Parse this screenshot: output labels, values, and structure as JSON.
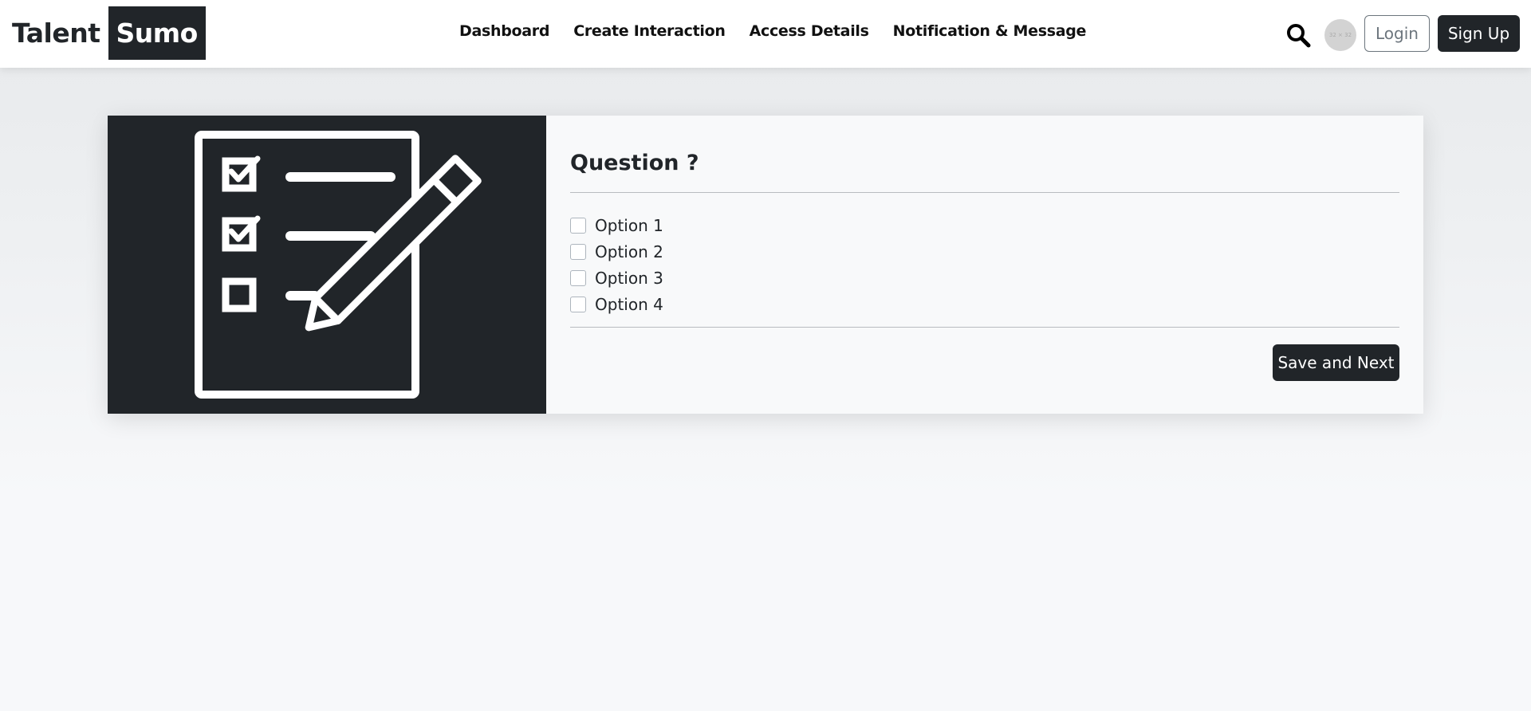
{
  "header": {
    "brand": {
      "part1": "Talent",
      "part2": "Sumo"
    },
    "nav": [
      "Dashboard",
      "Create Interaction",
      "Access Details",
      "Notification & Message"
    ],
    "search_icon": "search-icon",
    "avatar_text": "32 × 32",
    "login_label": "Login",
    "signup_label": "Sign Up"
  },
  "card": {
    "image_icon": "checklist-pencil-icon",
    "question": "Question ?",
    "options": [
      "Option 1",
      "Option 2",
      "Option 3",
      "Option 4"
    ],
    "next_label": "Save and Next"
  },
  "colors": {
    "dark": "#212529",
    "page_bg": "#f7f8fa",
    "card_bg": "#f8f9fa"
  }
}
